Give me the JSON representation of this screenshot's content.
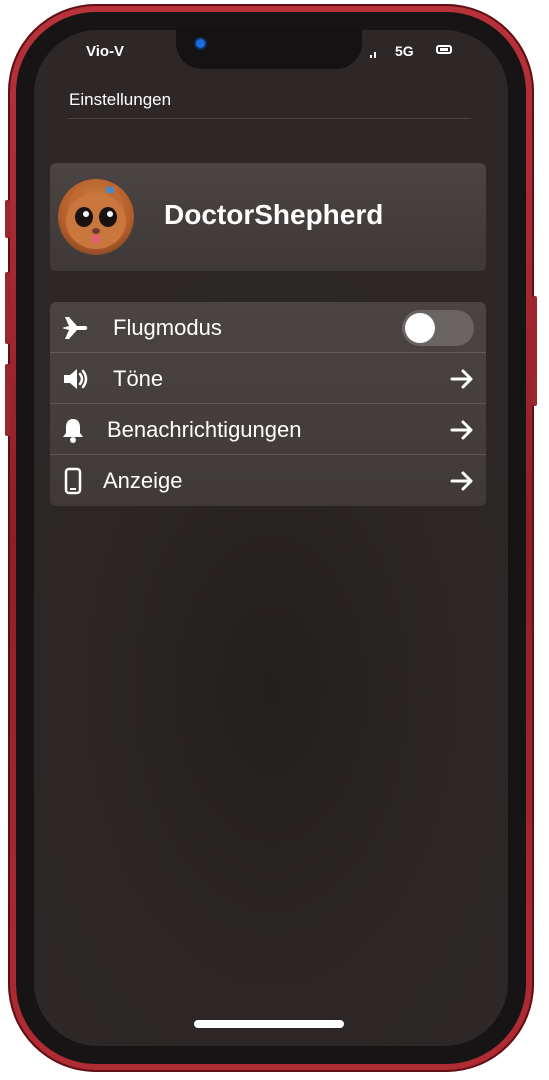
{
  "status_bar": {
    "carrier": "Vio-V",
    "network": "5G",
    "signal_icon": "signal-icon",
    "battery_icon": "battery-icon"
  },
  "header": {
    "title": "Einstellungen"
  },
  "profile": {
    "name": "DoctorShepherd",
    "avatar_icon": "cat-avatar"
  },
  "settings": {
    "items": [
      {
        "label": "Flugmodus",
        "icon": "airplane-icon",
        "control": "toggle",
        "enabled": false
      },
      {
        "label": "Töne",
        "icon": "speaker-icon",
        "control": "arrow-right-icon"
      },
      {
        "label": "Benachrichtigungen",
        "icon": "bell-icon",
        "control": "arrow-right-icon"
      },
      {
        "label": "Anzeige",
        "icon": "phone-icon",
        "control": "arrow-right-icon"
      }
    ]
  },
  "colors": {
    "frame": "#b8323a",
    "screen_bg": "#2b2625",
    "card_bg": "#4a4442",
    "camera": "#1e6ae0",
    "text": "#ffffff"
  }
}
